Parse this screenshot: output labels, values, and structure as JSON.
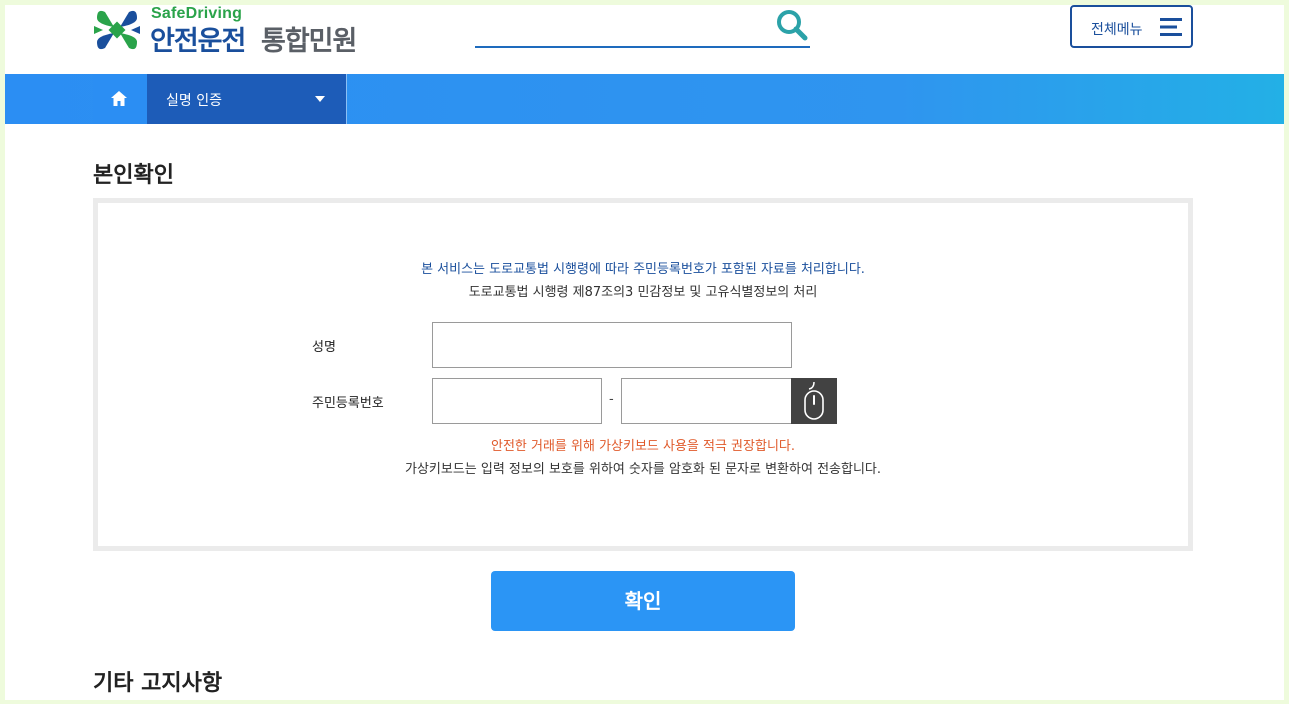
{
  "header": {
    "logo_en": "SafeDriving",
    "logo_ko_primary": "안전운전",
    "logo_ko_secondary": "통합민원",
    "search_placeholder": "",
    "menu_label": "전체메뉴"
  },
  "nav": {
    "select_label": "실명 인증"
  },
  "main": {
    "title": "본인확인",
    "notice_primary": "본 서비스는 도로교통법 시행령에 따라 주민등록번호가 포함된 자료를 처리합니다.",
    "notice_secondary": "도로교통법 시행령 제87조의3 민감정보 및 고유식별정보의 처리",
    "name_label": "성명",
    "name_value": "",
    "rrn_label": "주민등록번호",
    "rrn_front_value": "",
    "rrn_back_value": "",
    "rrn_dash": "-",
    "keyboard_warning": "안전한 거래를 위해 가상키보드 사용을 적극 권장합니다.",
    "keyboard_info": "가상키보드는 입력 정보의 보호를 위하여 숫자를 암호화 된 문자로 변환하여 전송합니다.",
    "confirm_label": "확인",
    "other_title": "기타 고지사항"
  },
  "colors": {
    "brand_blue": "#1a4f9c",
    "brand_green": "#2aa34a",
    "nav_blue": "#2b8ef3",
    "nav_dark": "#1d5cb8",
    "button_blue": "#2b95f5",
    "warning_orange": "#e05a2b"
  },
  "icons": {
    "logo": "cross-logo-icon",
    "search": "search-icon",
    "menu": "hamburger-icon",
    "home": "home-icon",
    "dropdown": "caret-down-icon",
    "virtual_keyboard": "mouse-icon"
  }
}
